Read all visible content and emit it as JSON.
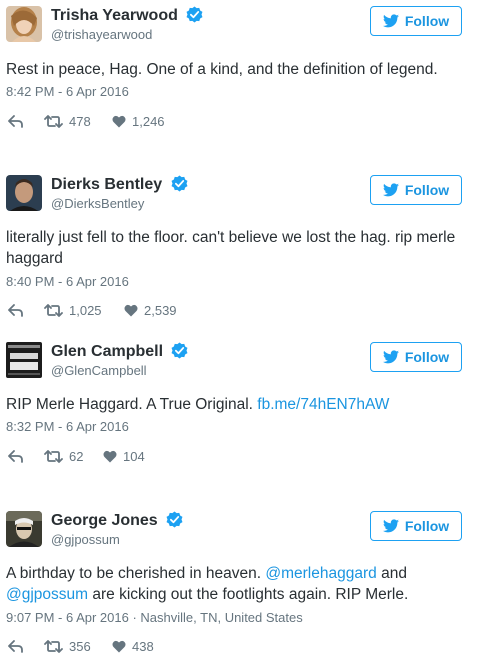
{
  "follow_label": "Follow",
  "colors": {
    "accent": "#1b95e0",
    "verified": "#1da1f2",
    "meta": "#66757f",
    "text": "#292f33"
  },
  "tweets": [
    {
      "name": "Trisha Yearwood",
      "handle": "@trishayearwood",
      "text_parts": [
        "Rest in peace, Hag. One of a kind, and the definition of legend."
      ],
      "time": "8:42 PM - 6 Apr 2016",
      "retweets": "478",
      "likes": "1,246",
      "icons": [
        "reply-icon",
        "retweet-icon",
        "heart-icon",
        "verified-icon",
        "twitter-bird-icon"
      ]
    },
    {
      "name": "Dierks Bentley",
      "handle": "@DierksBentley",
      "text_parts": [
        "literally just fell to the floor. can't believe we lost the hag. rip merle haggard"
      ],
      "time": "8:40 PM - 6 Apr 2016",
      "retweets": "1,025",
      "likes": "2,539"
    },
    {
      "name": "Glen Campbell",
      "handle": "@GlenCampbell",
      "text_parts": [
        "RIP Merle Haggard. A True Original. ",
        "fb.me/74hEN7hAW"
      ],
      "time": "8:32 PM - 6 Apr 2016",
      "retweets": "62",
      "likes": "104"
    },
    {
      "name": "George Jones",
      "handle": "@gjpossum",
      "text_parts": [
        "A birthday to be cherished in heaven. ",
        "@merlehaggard",
        " and ",
        "@gjpossum",
        " are kicking out the footlights again. RIP Merle."
      ],
      "time": "9:07 PM - 6 Apr 2016 · Nashville, TN, United States",
      "retweets": "356",
      "likes": "438"
    }
  ]
}
